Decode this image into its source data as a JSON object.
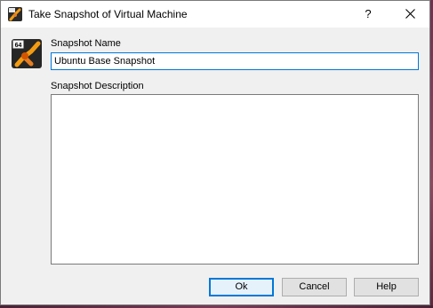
{
  "window": {
    "title": "Take Snapshot of Virtual Machine",
    "help_label": "?",
    "close_label": "✕"
  },
  "vm_icon": {
    "badge": "64",
    "icon": "virtualbox-ubuntu-vm-icon"
  },
  "form": {
    "name_label": "Snapshot Name",
    "name_value": "Ubuntu Base Snapshot",
    "description_label": "Snapshot Description",
    "description_value": ""
  },
  "buttons": {
    "ok": "Ok",
    "cancel": "Cancel",
    "help": "Help"
  },
  "colors": {
    "focus_accent": "#0078d7",
    "dialog_bg": "#f0f0f0",
    "desktop_bg": "#5a2a3e"
  }
}
